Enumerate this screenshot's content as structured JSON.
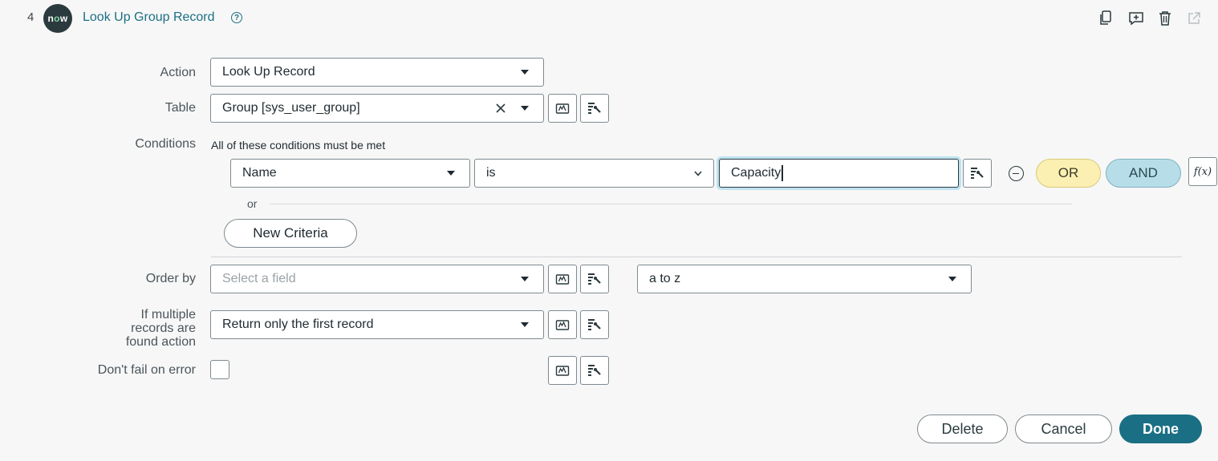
{
  "header": {
    "step_number": "4",
    "logo_text_before": "n",
    "logo_text_o": "o",
    "logo_text_after": "w",
    "title": "Look Up Group Record",
    "help_icon": "question-circle-icon",
    "icons": [
      "copy-icon",
      "add-comment-icon",
      "trash-icon",
      "external-link-icon"
    ]
  },
  "action": {
    "label": "Action",
    "value": "Look Up Record"
  },
  "table": {
    "label": "Table",
    "value": "Group [sys_user_group]"
  },
  "conditions": {
    "label": "Conditions",
    "heading": "All of these conditions must be met",
    "field": "Name",
    "operator": "is",
    "value": "Capacity",
    "or_button": "OR",
    "and_button": "AND",
    "fx_button": "f(x)",
    "or_separator": "or",
    "new_criteria": "New Criteria"
  },
  "order_by": {
    "label": "Order by",
    "placeholder": "Select a field",
    "direction": "a to z"
  },
  "multiple": {
    "label_lines": [
      "If multiple",
      "records are",
      "found action"
    ],
    "value": "Return only the first record"
  },
  "dont_fail": {
    "label": "Don't fail on error",
    "checked": false
  },
  "footer": {
    "delete": "Delete",
    "cancel": "Cancel",
    "done": "Done"
  },
  "colors": {
    "accent": "#1b6f84",
    "or_pill": "#fbf0b1",
    "and_pill": "#b7dde8",
    "background": "#f7f7f7"
  }
}
